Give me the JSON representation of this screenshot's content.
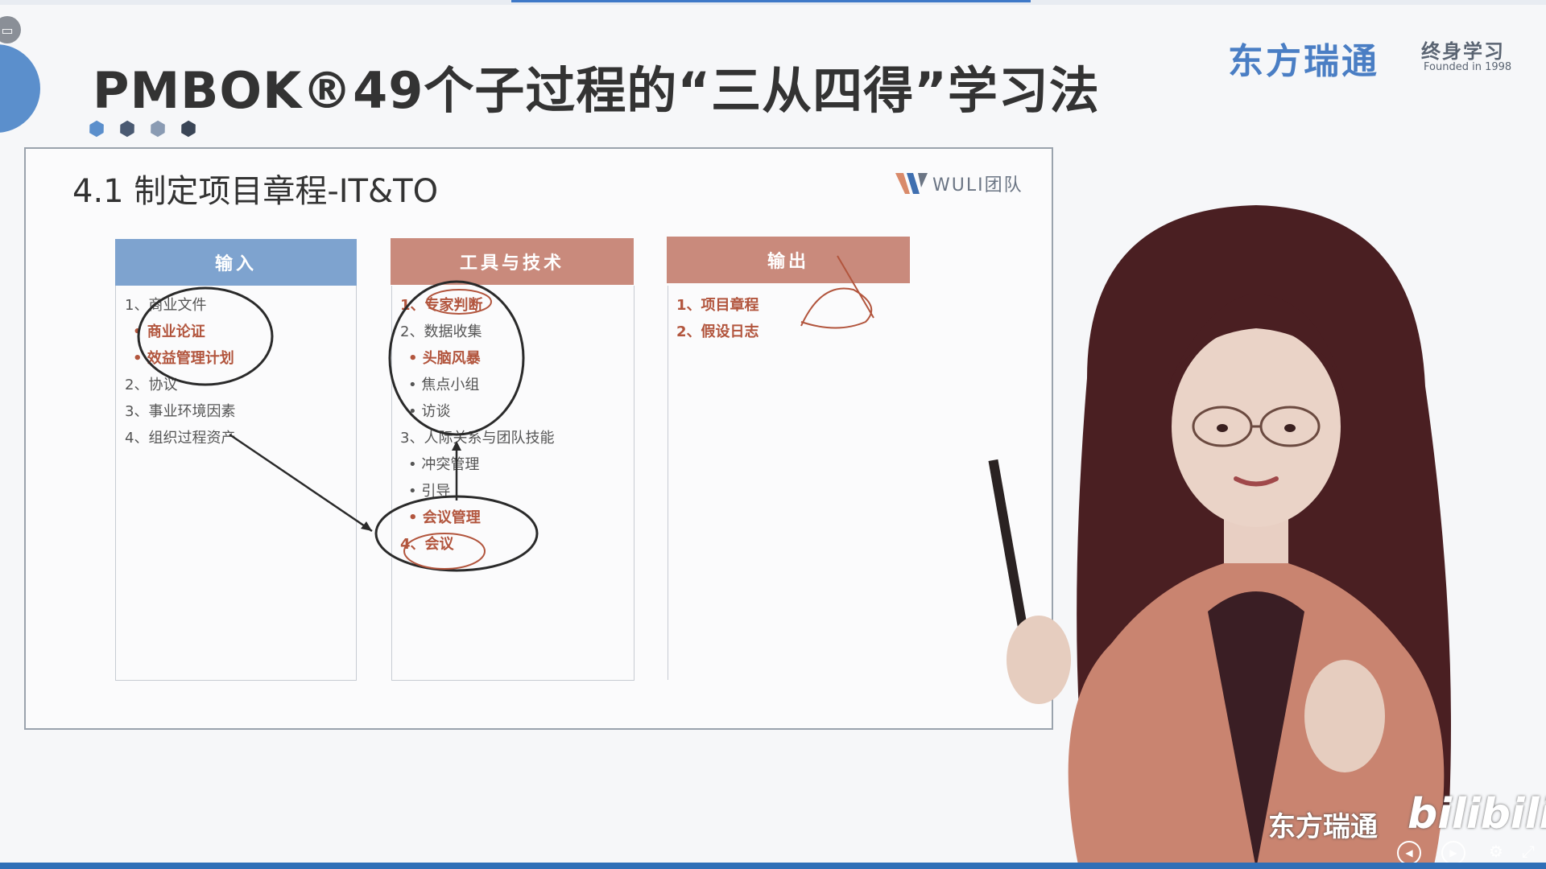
{
  "slide": {
    "title": "PMBOK®49个子过程的“三从四得”学习法",
    "section_heading": "4.1 制定项目章程-IT&TO",
    "wuli_logo": "WULI团队"
  },
  "brand": {
    "name": "东方瑞通",
    "sub": "终身学习",
    "founded": "Founded in 1998"
  },
  "dots": [
    "#5b8fcc",
    "#4a5a72",
    "#8a9bb3",
    "#3a4556"
  ],
  "columns": [
    {
      "header": "输入",
      "color": "#7ea3cf",
      "items": [
        {
          "text": "1、商业文件",
          "hl": false
        },
        {
          "text": "• 商业论证",
          "hl": true
        },
        {
          "text": "• 效益管理计划",
          "hl": true
        },
        {
          "text": "2、协议",
          "hl": false
        },
        {
          "text": "3、事业环境因素",
          "hl": false
        },
        {
          "text": "4、组织过程资产",
          "hl": false
        }
      ]
    },
    {
      "header": "工具与技术",
      "color": "#c98a7c",
      "items": [
        {
          "text": "1、专家判断",
          "hl": true
        },
        {
          "text": "2、数据收集",
          "hl": false
        },
        {
          "text": "• 头脑风暴",
          "hl": true
        },
        {
          "text": "• 焦点小组",
          "hl": false
        },
        {
          "text": "• 访谈",
          "hl": false
        },
        {
          "text": "3、人际关系与团队技能",
          "hl": false
        },
        {
          "text": "• 冲突管理",
          "hl": false
        },
        {
          "text": "• 引导",
          "hl": false
        },
        {
          "text": "• 会议管理",
          "hl": true
        },
        {
          "text": "4、会议",
          "hl": true
        }
      ]
    },
    {
      "header": "输出",
      "color": "#c98a7c",
      "items": [
        {
          "text": "1、项目章程",
          "hl": true
        },
        {
          "text": "2、假设日志",
          "hl": true
        }
      ]
    }
  ],
  "watermark": {
    "text": "东方瑞通",
    "platform": "bilibili"
  },
  "player_controls": [
    "prev-icon",
    "play-icon",
    "settings-icon",
    "fullscreen-icon"
  ]
}
